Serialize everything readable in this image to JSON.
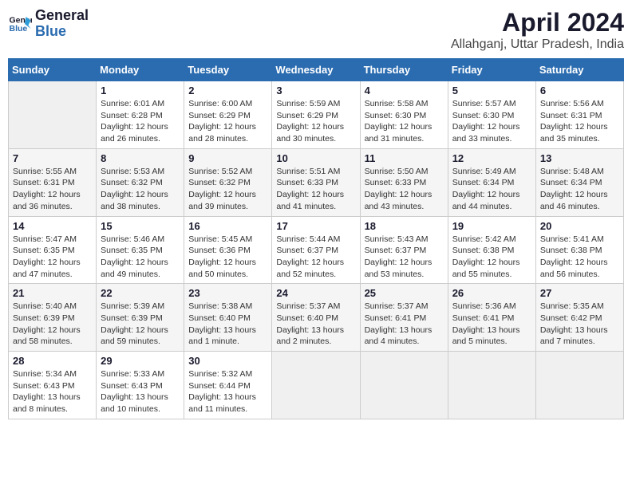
{
  "header": {
    "logo_line1": "General",
    "logo_line2": "Blue",
    "title": "April 2024",
    "subtitle": "Allahganj, Uttar Pradesh, India"
  },
  "days_of_week": [
    "Sunday",
    "Monday",
    "Tuesday",
    "Wednesday",
    "Thursday",
    "Friday",
    "Saturday"
  ],
  "weeks": [
    [
      {
        "day": "",
        "info": ""
      },
      {
        "day": "1",
        "info": "Sunrise: 6:01 AM\nSunset: 6:28 PM\nDaylight: 12 hours\nand 26 minutes."
      },
      {
        "day": "2",
        "info": "Sunrise: 6:00 AM\nSunset: 6:29 PM\nDaylight: 12 hours\nand 28 minutes."
      },
      {
        "day": "3",
        "info": "Sunrise: 5:59 AM\nSunset: 6:29 PM\nDaylight: 12 hours\nand 30 minutes."
      },
      {
        "day": "4",
        "info": "Sunrise: 5:58 AM\nSunset: 6:30 PM\nDaylight: 12 hours\nand 31 minutes."
      },
      {
        "day": "5",
        "info": "Sunrise: 5:57 AM\nSunset: 6:30 PM\nDaylight: 12 hours\nand 33 minutes."
      },
      {
        "day": "6",
        "info": "Sunrise: 5:56 AM\nSunset: 6:31 PM\nDaylight: 12 hours\nand 35 minutes."
      }
    ],
    [
      {
        "day": "7",
        "info": "Sunrise: 5:55 AM\nSunset: 6:31 PM\nDaylight: 12 hours\nand 36 minutes."
      },
      {
        "day": "8",
        "info": "Sunrise: 5:53 AM\nSunset: 6:32 PM\nDaylight: 12 hours\nand 38 minutes."
      },
      {
        "day": "9",
        "info": "Sunrise: 5:52 AM\nSunset: 6:32 PM\nDaylight: 12 hours\nand 39 minutes."
      },
      {
        "day": "10",
        "info": "Sunrise: 5:51 AM\nSunset: 6:33 PM\nDaylight: 12 hours\nand 41 minutes."
      },
      {
        "day": "11",
        "info": "Sunrise: 5:50 AM\nSunset: 6:33 PM\nDaylight: 12 hours\nand 43 minutes."
      },
      {
        "day": "12",
        "info": "Sunrise: 5:49 AM\nSunset: 6:34 PM\nDaylight: 12 hours\nand 44 minutes."
      },
      {
        "day": "13",
        "info": "Sunrise: 5:48 AM\nSunset: 6:34 PM\nDaylight: 12 hours\nand 46 minutes."
      }
    ],
    [
      {
        "day": "14",
        "info": "Sunrise: 5:47 AM\nSunset: 6:35 PM\nDaylight: 12 hours\nand 47 minutes."
      },
      {
        "day": "15",
        "info": "Sunrise: 5:46 AM\nSunset: 6:35 PM\nDaylight: 12 hours\nand 49 minutes."
      },
      {
        "day": "16",
        "info": "Sunrise: 5:45 AM\nSunset: 6:36 PM\nDaylight: 12 hours\nand 50 minutes."
      },
      {
        "day": "17",
        "info": "Sunrise: 5:44 AM\nSunset: 6:37 PM\nDaylight: 12 hours\nand 52 minutes."
      },
      {
        "day": "18",
        "info": "Sunrise: 5:43 AM\nSunset: 6:37 PM\nDaylight: 12 hours\nand 53 minutes."
      },
      {
        "day": "19",
        "info": "Sunrise: 5:42 AM\nSunset: 6:38 PM\nDaylight: 12 hours\nand 55 minutes."
      },
      {
        "day": "20",
        "info": "Sunrise: 5:41 AM\nSunset: 6:38 PM\nDaylight: 12 hours\nand 56 minutes."
      }
    ],
    [
      {
        "day": "21",
        "info": "Sunrise: 5:40 AM\nSunset: 6:39 PM\nDaylight: 12 hours\nand 58 minutes."
      },
      {
        "day": "22",
        "info": "Sunrise: 5:39 AM\nSunset: 6:39 PM\nDaylight: 12 hours\nand 59 minutes."
      },
      {
        "day": "23",
        "info": "Sunrise: 5:38 AM\nSunset: 6:40 PM\nDaylight: 13 hours\nand 1 minute."
      },
      {
        "day": "24",
        "info": "Sunrise: 5:37 AM\nSunset: 6:40 PM\nDaylight: 13 hours\nand 2 minutes."
      },
      {
        "day": "25",
        "info": "Sunrise: 5:37 AM\nSunset: 6:41 PM\nDaylight: 13 hours\nand 4 minutes."
      },
      {
        "day": "26",
        "info": "Sunrise: 5:36 AM\nSunset: 6:41 PM\nDaylight: 13 hours\nand 5 minutes."
      },
      {
        "day": "27",
        "info": "Sunrise: 5:35 AM\nSunset: 6:42 PM\nDaylight: 13 hours\nand 7 minutes."
      }
    ],
    [
      {
        "day": "28",
        "info": "Sunrise: 5:34 AM\nSunset: 6:43 PM\nDaylight: 13 hours\nand 8 minutes."
      },
      {
        "day": "29",
        "info": "Sunrise: 5:33 AM\nSunset: 6:43 PM\nDaylight: 13 hours\nand 10 minutes."
      },
      {
        "day": "30",
        "info": "Sunrise: 5:32 AM\nSunset: 6:44 PM\nDaylight: 13 hours\nand 11 minutes."
      },
      {
        "day": "",
        "info": ""
      },
      {
        "day": "",
        "info": ""
      },
      {
        "day": "",
        "info": ""
      },
      {
        "day": "",
        "info": ""
      }
    ]
  ]
}
